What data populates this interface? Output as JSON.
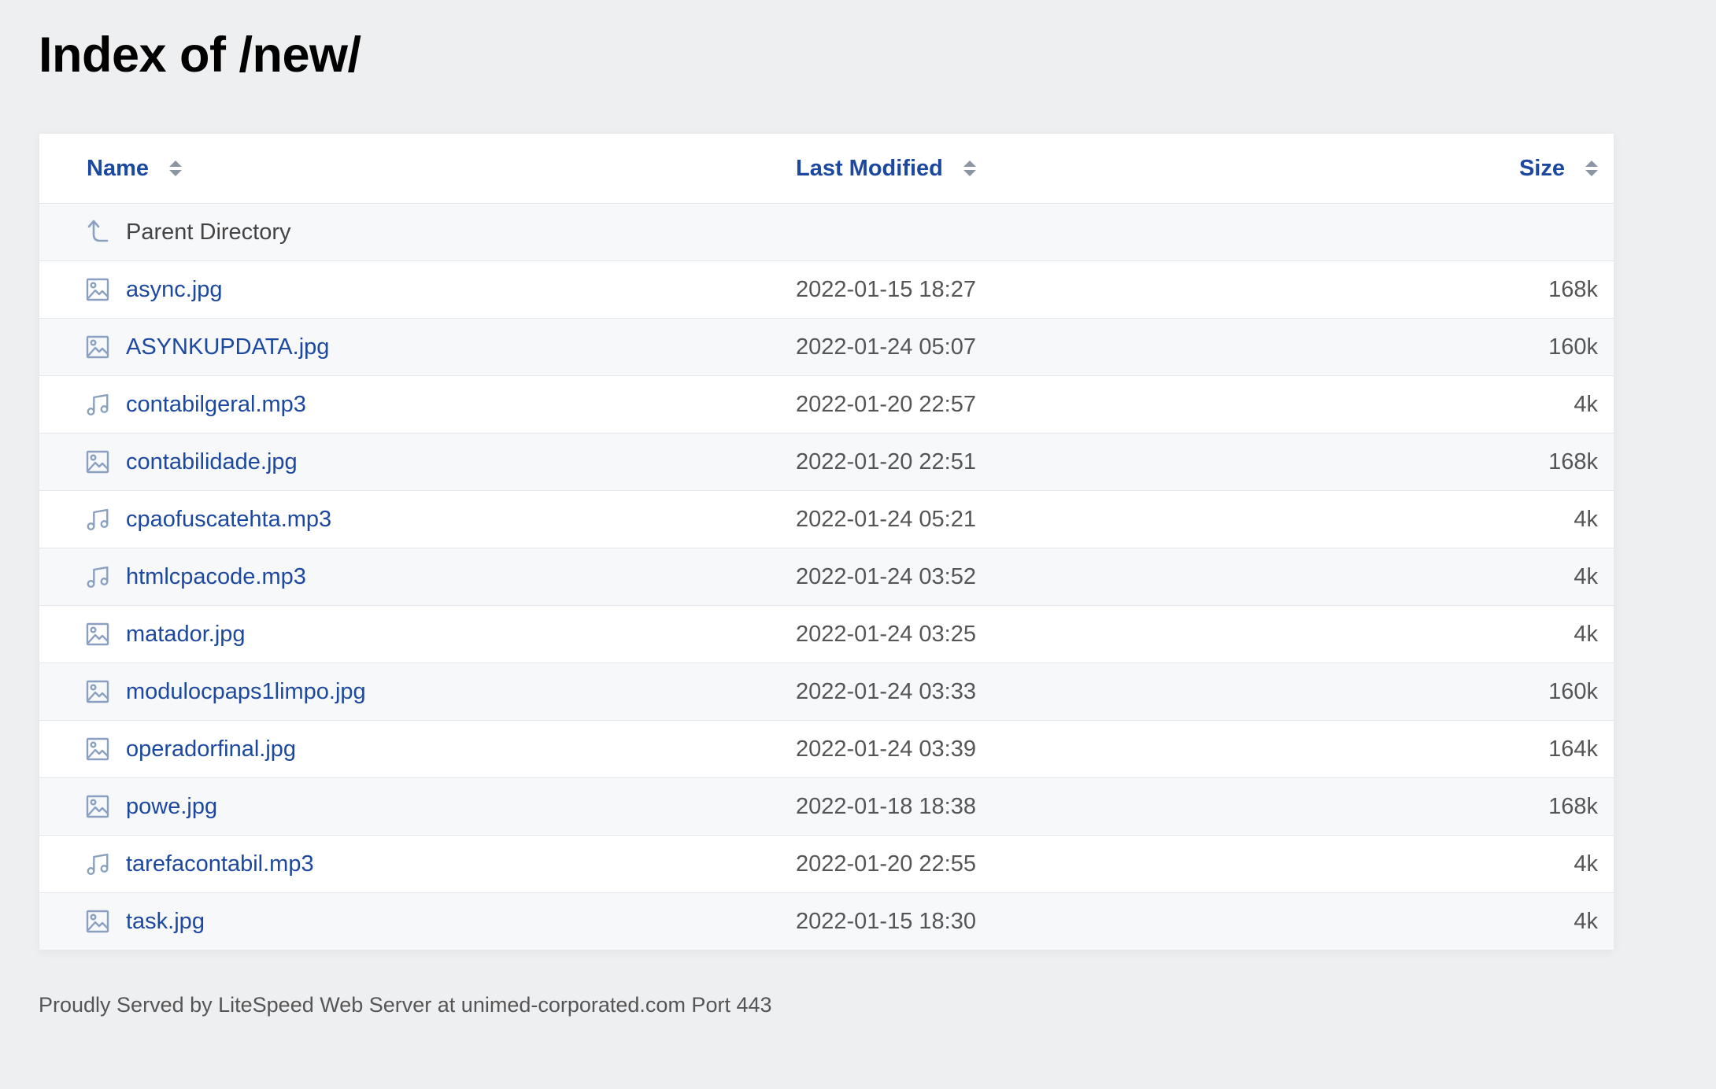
{
  "title": "Index of /new/",
  "table": {
    "headers": {
      "name": "Name",
      "modified": "Last Modified",
      "size": "Size"
    },
    "parent": {
      "label": "Parent Directory",
      "icon": "parent-directory-icon"
    },
    "rows": [
      {
        "name": "async.jpg",
        "modified": "2022-01-15 18:27",
        "size": "168k",
        "icon": "image-icon"
      },
      {
        "name": "ASYNKUPDATA.jpg",
        "modified": "2022-01-24 05:07",
        "size": "160k",
        "icon": "image-icon"
      },
      {
        "name": "contabilgeral.mp3",
        "modified": "2022-01-20 22:57",
        "size": "4k",
        "icon": "music-icon"
      },
      {
        "name": "contabilidade.jpg",
        "modified": "2022-01-20 22:51",
        "size": "168k",
        "icon": "image-icon"
      },
      {
        "name": "cpaofuscatehta.mp3",
        "modified": "2022-01-24 05:21",
        "size": "4k",
        "icon": "music-icon"
      },
      {
        "name": "htmlcpacode.mp3",
        "modified": "2022-01-24 03:52",
        "size": "4k",
        "icon": "music-icon"
      },
      {
        "name": "matador.jpg",
        "modified": "2022-01-24 03:25",
        "size": "4k",
        "icon": "image-icon"
      },
      {
        "name": "modulocpaps1limpo.jpg",
        "modified": "2022-01-24 03:33",
        "size": "160k",
        "icon": "image-icon"
      },
      {
        "name": "operadorfinal.jpg",
        "modified": "2022-01-24 03:39",
        "size": "164k",
        "icon": "image-icon"
      },
      {
        "name": "powe.jpg",
        "modified": "2022-01-18 18:38",
        "size": "168k",
        "icon": "image-icon"
      },
      {
        "name": "tarefacontabil.mp3",
        "modified": "2022-01-20 22:55",
        "size": "4k",
        "icon": "music-icon"
      },
      {
        "name": "task.jpg",
        "modified": "2022-01-15 18:30",
        "size": "4k",
        "icon": "image-icon"
      }
    ]
  },
  "footer": "Proudly Served by LiteSpeed Web Server at unimed-corporated.com Port 443",
  "colors": {
    "link": "#1d48a0",
    "icon": "#8aa0c0",
    "background": "#eeeff1"
  }
}
